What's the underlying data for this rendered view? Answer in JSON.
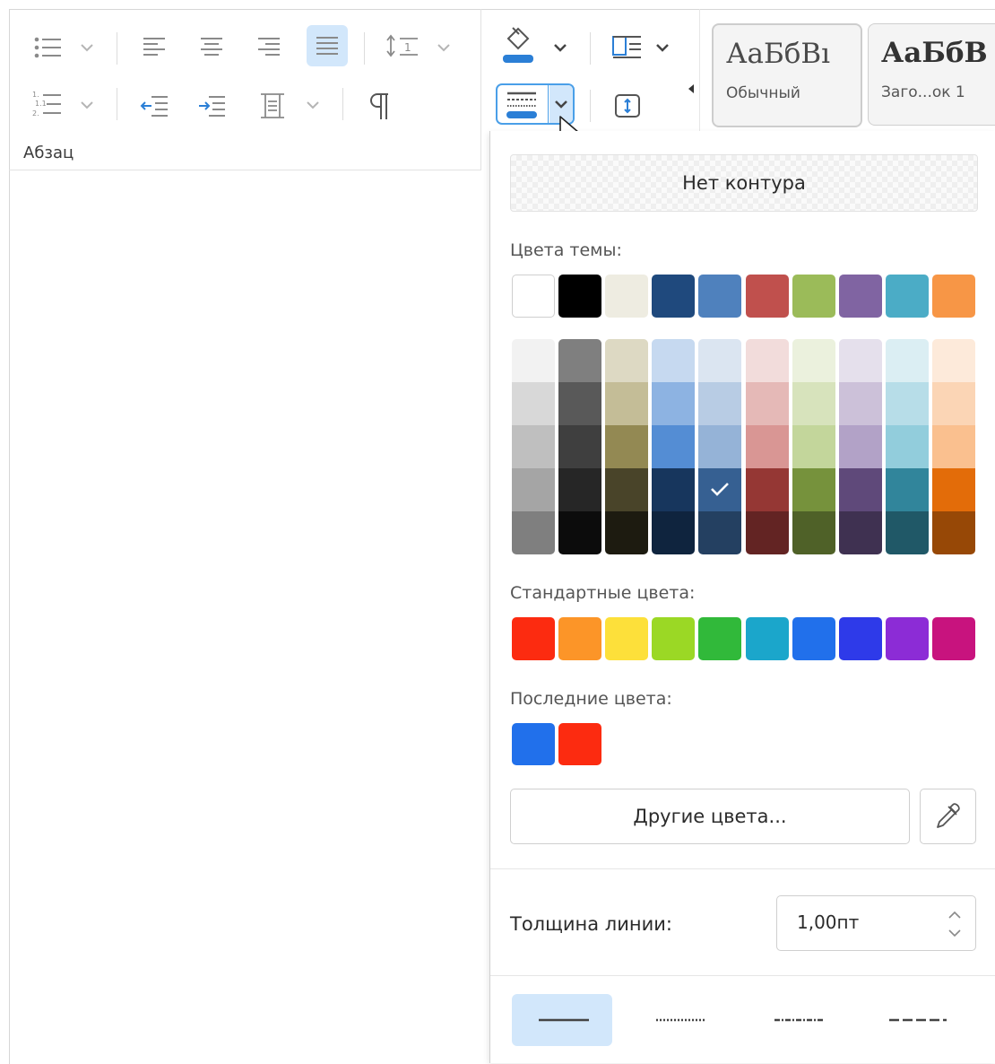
{
  "paragraph_group": {
    "label": "Абзац"
  },
  "styles": [
    {
      "preview": "АаБбВı",
      "name": "Обычный"
    },
    {
      "preview": "АаБбВ",
      "name": "Заго...ок 1"
    }
  ],
  "panel": {
    "no_outline": "Нет контура",
    "theme_colors_label": "Цвета темы:",
    "theme_colors": [
      "#ffffff",
      "#000000",
      "#eeece1",
      "#1f497d",
      "#4f81bd",
      "#c0504d",
      "#9bbb59",
      "#8064a2",
      "#4bacc6",
      "#f79646"
    ],
    "theme_shades": [
      [
        "#f2f2f2",
        "#d8d8d8",
        "#bfbfbf",
        "#a5a5a5",
        "#7f7f7f"
      ],
      [
        "#7f7f7f",
        "#595959",
        "#3f3f3f",
        "#262626",
        "#0c0c0c"
      ],
      [
        "#ddd9c3",
        "#c4bd97",
        "#938953",
        "#494429",
        "#1d1b10"
      ],
      [
        "#c6d9f0",
        "#8db3e2",
        "#548dd4",
        "#17365d",
        "#0f243e"
      ],
      [
        "#dbe5f1",
        "#b8cce4",
        "#95b3d7",
        "#366092",
        "#244061"
      ],
      [
        "#f2dcdb",
        "#e5b9b7",
        "#d99694",
        "#953734",
        "#632423"
      ],
      [
        "#ebf1dd",
        "#d7e3bc",
        "#c3d69b",
        "#76923c",
        "#4f6128"
      ],
      [
        "#e5e0ec",
        "#ccc1d9",
        "#b2a2c7",
        "#5f497a",
        "#3f3151"
      ],
      [
        "#dbeef3",
        "#b7dde8",
        "#92cddc",
        "#31859b",
        "#205867"
      ],
      [
        "#fdeada",
        "#fbd5b5",
        "#fac08f",
        "#e36c09",
        "#974806"
      ]
    ],
    "selected_shade": "#366092",
    "standard_colors_label": "Стандартные цвета:",
    "standard_colors": [
      "#fc2b10",
      "#fc9528",
      "#fde03a",
      "#9bd825",
      "#31b93a",
      "#1ba6cb",
      "#2170eb",
      "#2e3ae9",
      "#8c2cd6",
      "#c8137e"
    ],
    "recent_colors_label": "Последние цвета:",
    "recent_colors": [
      "#2170eb",
      "#fc2b10"
    ],
    "other_colors_label": "Другие цвета...",
    "thickness_label": "Толщина линии:",
    "thickness_value": "1,00пт",
    "line_styles": [
      "solid",
      "dotted",
      "dash-dot",
      "dashed"
    ],
    "selected_line_style": "solid"
  },
  "colors": {
    "accent": "#4a9fe8",
    "selected_bg": "#d2e7fb",
    "icon_gray": "#8a8a8a",
    "icon_blue": "#2b7fd6"
  },
  "icons": [
    "bulleted-list-icon",
    "numbered-list-icon",
    "align-left-icon",
    "align-center-icon",
    "align-right-icon",
    "justify-icon",
    "line-spacing-icon",
    "decrease-indent-icon",
    "increase-indent-icon",
    "paragraph-spacing-icon",
    "pilcrow-icon",
    "fill-color-icon",
    "outline-style-icon",
    "borders-icon",
    "vertical-align-icon",
    "mouse-cursor-icon",
    "eyedropper-icon",
    "spinner-icon",
    "checkmark-icon"
  ]
}
